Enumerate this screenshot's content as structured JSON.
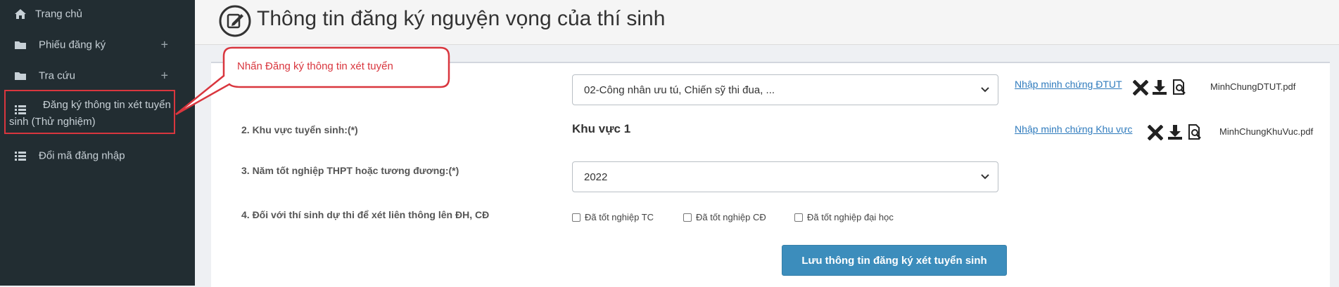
{
  "sidebar": {
    "items": [
      {
        "label": "Trang chủ",
        "icon": "home-icon"
      },
      {
        "label": "Phiếu đăng ký",
        "icon": "folder-icon",
        "expand": "+"
      },
      {
        "label": "Tra cứu",
        "icon": "folder-icon",
        "expand": "+"
      },
      {
        "label": "Đăng ký thông tin xét tuyển sinh (Thử nghiệm)",
        "icon": "list-icon"
      },
      {
        "label": "Đổi mã đăng nhập",
        "icon": "list-icon"
      }
    ]
  },
  "header": {
    "title": "Thông tin đăng ký nguyện vọng của thí sinh"
  },
  "callout": {
    "text": "Nhấn Đăng ký thông tin xét tuyển"
  },
  "form": {
    "priority": {
      "selected": "02-Công nhân ưu tú, Chiến sỹ thi đua, ...",
      "evidence_link": "Nhập minh chứng ĐTUT",
      "file": "MinhChungDTUT.pdf"
    },
    "region": {
      "label": "2. Khu vực tuyển sinh:(*)",
      "value": "Khu vực 1",
      "evidence_link": "Nhập minh chứng Khu vực",
      "file": "MinhChungKhuVuc.pdf"
    },
    "grad_year": {
      "label": "3. Năm tốt nghiệp THPT hoặc tương đương:(*)",
      "selected": "2022"
    },
    "transfer": {
      "label": "4. Đối với thí sinh dự thi để xét liên thông lên ĐH, CĐ",
      "options": [
        "Đã tốt nghiệp TC",
        "Đã tốt nghiệp CĐ",
        "Đã tốt nghiệp đại học"
      ]
    },
    "save_label": "Lưu thông tin đăng ký xét tuyển sinh"
  },
  "colors": {
    "sidebar_bg": "#222d32",
    "accent": "#3c8dbc",
    "highlight": "#d9363e",
    "link": "#2f7bbd"
  }
}
